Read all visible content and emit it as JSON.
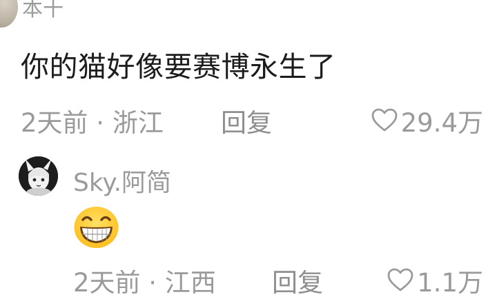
{
  "comment": {
    "username_partial": "本十",
    "text": "你的猫好像要赛博永生了",
    "time_location": "2天前 · 浙江",
    "reply_label": "回复",
    "like_icon": "heart-outline-icon",
    "like_count": "29.4万"
  },
  "reply": {
    "avatar_icon": "anime-avatar-icon",
    "username": "Sky.阿简",
    "emoji": "grinning-face-emoji",
    "time_location_partial": "2天前 · 江西",
    "reply_label": "回复",
    "like_icon": "heart-outline-icon",
    "like_count_partial": "1.1万"
  },
  "colors": {
    "text_primary": "#1c1c1c",
    "text_secondary": "#9a9a9a",
    "background": "#ffffff",
    "emoji_yellow": "#ffcc33"
  }
}
